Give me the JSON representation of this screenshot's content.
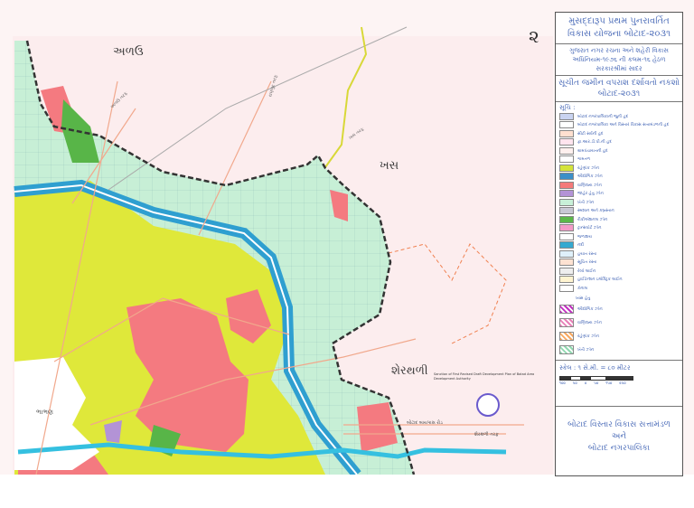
{
  "sheet_number": "૨",
  "title_block": {
    "title": "મુસદ્દારૂપ પ્રથમ પુનરાવર્તિત વિકાસ યોજના બોટાદ-૨૦૩૧",
    "subtitle": "ગુજરાત નગર રચના અને શહેરી વિકાસ અધિનિયમ-૧૯૭૬ ની કલમ-૧૬ હેઠળ સરકારશ્રીમાં સાદર",
    "map_title": "સૂચીત જમીન વપરાશ દર્શાવતો નકશો બોટાદ-૨૦૩૧"
  },
  "legend": {
    "title": "સૂચિ :",
    "items": [
      {
        "label": "બોટાદ નગરપાલિકાની જુની હદ",
        "color": "#c9d3f0"
      },
      {
        "label": "બોટાદ નગરપાલિકા અને વિસ્તાર વિકાસ સત્તામંડળની હદ",
        "color": "#ffffff"
      },
      {
        "label": "સીટી સર્વેની હદ",
        "color": "#ffe0d0"
      },
      {
        "label": "ફા.આર.ડી.પી.ની હદ",
        "color": "#ffe4ee"
      },
      {
        "label": "ગ્રામપંચાયતની હદ",
        "color": "#fff0ee"
      },
      {
        "label": "ગામતળ",
        "color": "#ffffff"
      },
      {
        "label": "રહેણાંક ઝોન",
        "color": "#d4e33a"
      },
      {
        "label": "ઔદ્યોગિક ઝોન",
        "color": "#3c8fc8"
      },
      {
        "label": "વાણિજ્ય ઝોન",
        "color": "#f47a7a"
      },
      {
        "label": "જાહેર હેતુ ઝોન",
        "color": "#b393d6"
      },
      {
        "label": "ખેતી ઝોન",
        "color": "#c8f0d8"
      },
      {
        "label": "સ્મશાન અને કબ્રસ્તાન",
        "color": "#c8c8d4"
      },
      {
        "label": "રીક્રીએશનલ ઝોન",
        "color": "#5cb84a"
      },
      {
        "label": "ટ્રાન્સપોર્ટ ઝોન",
        "color": "#f49ac8"
      },
      {
        "label": "જળાશય",
        "color": "#ffffff"
      },
      {
        "label": "નદી",
        "color": "#35a9d0"
      },
      {
        "label": "હયાત રસ્તા",
        "color": "#dff0fa"
      },
      {
        "label": "સૂચિત રસ્તા",
        "color": "#fde2d2"
      },
      {
        "label": "રેલ્વે લાઈન",
        "color": "#eeeeee"
      },
      {
        "label": "હાઈટેન્શન ઇલેક્ટ્રિક લાઈન",
        "color": "#fff4d0"
      },
      {
        "label": "કેનાલ",
        "color": "#ffffff"
      }
    ],
    "hatched_title": "ખાસ હેતુ",
    "hatched": [
      {
        "label": "ઔદ્યોગિક ઝોન",
        "color": "#c030c0"
      },
      {
        "label": "વાણિજ્ય ઝોન",
        "color": "#e880b8"
      },
      {
        "label": "રહેણાંક ઝોન",
        "color": "#f8a860"
      },
      {
        "label": "ખેતી ઝોન",
        "color": "#90d8b0"
      }
    ]
  },
  "scale": {
    "text": "સ્કેલ : ૧ સે.મી. = ૮૦ મીટર",
    "ticks": [
      "૧૦૦",
      "૫૦",
      "૦",
      "૫૦",
      "૧૫૦",
      "૨૫૦"
    ]
  },
  "organization": {
    "line1": "બોટાદ વિસ્તાર વિકાસ સત્તામંડળ",
    "line2": "અને",
    "line3": "બોટાદ નગરપાલિકા"
  },
  "places": {
    "north": "અળઉ",
    "east": "ખસ",
    "southeast": "શેરથળી",
    "southwest": "ભાભણ"
  },
  "road_labels": {
    "r1": "અળઉ તરફ",
    "r2": "રાણપુર તરફ",
    "r3": "ખસ તરફ",
    "r4": "શેરથળી તરફ",
    "r5": "બોટાદ બાયપાસ રોડ"
  },
  "approval_note": "Sanction of First Revised Draft Development Plan of Botad Area Development Authority"
}
